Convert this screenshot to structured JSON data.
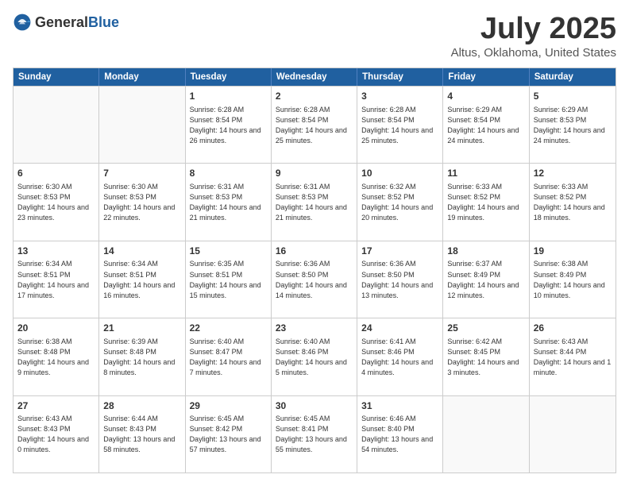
{
  "header": {
    "logo_general": "General",
    "logo_blue": "Blue",
    "month": "July 2025",
    "location": "Altus, Oklahoma, United States"
  },
  "calendar": {
    "days": [
      "Sunday",
      "Monday",
      "Tuesday",
      "Wednesday",
      "Thursday",
      "Friday",
      "Saturday"
    ],
    "rows": [
      [
        {
          "day": "",
          "empty": true
        },
        {
          "day": "",
          "empty": true
        },
        {
          "day": "1",
          "rise": "6:28 AM",
          "set": "8:54 PM",
          "daylight": "14 hours and 26 minutes."
        },
        {
          "day": "2",
          "rise": "6:28 AM",
          "set": "8:54 PM",
          "daylight": "14 hours and 25 minutes."
        },
        {
          "day": "3",
          "rise": "6:28 AM",
          "set": "8:54 PM",
          "daylight": "14 hours and 25 minutes."
        },
        {
          "day": "4",
          "rise": "6:29 AM",
          "set": "8:54 PM",
          "daylight": "14 hours and 24 minutes."
        },
        {
          "day": "5",
          "rise": "6:29 AM",
          "set": "8:53 PM",
          "daylight": "14 hours and 24 minutes."
        }
      ],
      [
        {
          "day": "6",
          "rise": "6:30 AM",
          "set": "8:53 PM",
          "daylight": "14 hours and 23 minutes."
        },
        {
          "day": "7",
          "rise": "6:30 AM",
          "set": "8:53 PM",
          "daylight": "14 hours and 22 minutes."
        },
        {
          "day": "8",
          "rise": "6:31 AM",
          "set": "8:53 PM",
          "daylight": "14 hours and 21 minutes."
        },
        {
          "day": "9",
          "rise": "6:31 AM",
          "set": "8:53 PM",
          "daylight": "14 hours and 21 minutes."
        },
        {
          "day": "10",
          "rise": "6:32 AM",
          "set": "8:52 PM",
          "daylight": "14 hours and 20 minutes."
        },
        {
          "day": "11",
          "rise": "6:33 AM",
          "set": "8:52 PM",
          "daylight": "14 hours and 19 minutes."
        },
        {
          "day": "12",
          "rise": "6:33 AM",
          "set": "8:52 PM",
          "daylight": "14 hours and 18 minutes."
        }
      ],
      [
        {
          "day": "13",
          "rise": "6:34 AM",
          "set": "8:51 PM",
          "daylight": "14 hours and 17 minutes."
        },
        {
          "day": "14",
          "rise": "6:34 AM",
          "set": "8:51 PM",
          "daylight": "14 hours and 16 minutes."
        },
        {
          "day": "15",
          "rise": "6:35 AM",
          "set": "8:51 PM",
          "daylight": "14 hours and 15 minutes."
        },
        {
          "day": "16",
          "rise": "6:36 AM",
          "set": "8:50 PM",
          "daylight": "14 hours and 14 minutes."
        },
        {
          "day": "17",
          "rise": "6:36 AM",
          "set": "8:50 PM",
          "daylight": "14 hours and 13 minutes."
        },
        {
          "day": "18",
          "rise": "6:37 AM",
          "set": "8:49 PM",
          "daylight": "14 hours and 12 minutes."
        },
        {
          "day": "19",
          "rise": "6:38 AM",
          "set": "8:49 PM",
          "daylight": "14 hours and 10 minutes."
        }
      ],
      [
        {
          "day": "20",
          "rise": "6:38 AM",
          "set": "8:48 PM",
          "daylight": "14 hours and 9 minutes."
        },
        {
          "day": "21",
          "rise": "6:39 AM",
          "set": "8:48 PM",
          "daylight": "14 hours and 8 minutes."
        },
        {
          "day": "22",
          "rise": "6:40 AM",
          "set": "8:47 PM",
          "daylight": "14 hours and 7 minutes."
        },
        {
          "day": "23",
          "rise": "6:40 AM",
          "set": "8:46 PM",
          "daylight": "14 hours and 5 minutes."
        },
        {
          "day": "24",
          "rise": "6:41 AM",
          "set": "8:46 PM",
          "daylight": "14 hours and 4 minutes."
        },
        {
          "day": "25",
          "rise": "6:42 AM",
          "set": "8:45 PM",
          "daylight": "14 hours and 3 minutes."
        },
        {
          "day": "26",
          "rise": "6:43 AM",
          "set": "8:44 PM",
          "daylight": "14 hours and 1 minute."
        }
      ],
      [
        {
          "day": "27",
          "rise": "6:43 AM",
          "set": "8:43 PM",
          "daylight": "14 hours and 0 minutes."
        },
        {
          "day": "28",
          "rise": "6:44 AM",
          "set": "8:43 PM",
          "daylight": "13 hours and 58 minutes."
        },
        {
          "day": "29",
          "rise": "6:45 AM",
          "set": "8:42 PM",
          "daylight": "13 hours and 57 minutes."
        },
        {
          "day": "30",
          "rise": "6:45 AM",
          "set": "8:41 PM",
          "daylight": "13 hours and 55 minutes."
        },
        {
          "day": "31",
          "rise": "6:46 AM",
          "set": "8:40 PM",
          "daylight": "13 hours and 54 minutes."
        },
        {
          "day": "",
          "empty": true
        },
        {
          "day": "",
          "empty": true
        }
      ]
    ]
  }
}
